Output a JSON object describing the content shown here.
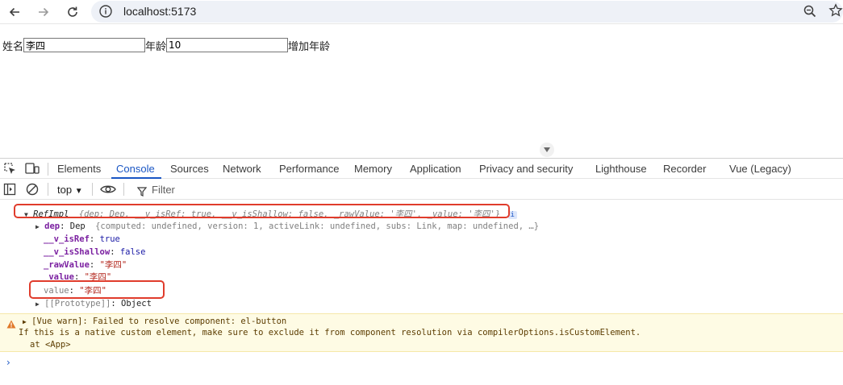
{
  "browser": {
    "url": "localhost:5173",
    "icons": [
      "back-icon",
      "forward-icon",
      "reload-icon",
      "site-info-icon",
      "zoom-icon",
      "bookmark-star-icon"
    ]
  },
  "page": {
    "name_label": "姓名",
    "name_value": "李四",
    "age_label": "年龄",
    "age_value": "10",
    "add_age_label": "增加年龄"
  },
  "devtools": {
    "tabs": [
      "Elements",
      "Console",
      "Sources",
      "Network",
      "Performance",
      "Memory",
      "Application",
      "Privacy and security",
      "Lighthouse",
      "Recorder",
      "Vue (Legacy)"
    ],
    "active_tab": "Console",
    "context": "top",
    "filter_placeholder": "Filter"
  },
  "console": {
    "object_summary": {
      "class_name": "RefImpl",
      "preview": "{dep: Dep, __v_isRef: true, __v_isShallow: false, _rawValue: '李四', _value: '李四'}",
      "info_badge": "i"
    },
    "dep_row": {
      "key": "dep",
      "type": "Dep",
      "preview": "{computed: undefined, version: 1, activeLink: undefined, subs: Link, map: undefined, …}"
    },
    "props": [
      {
        "key": "__v_isRef",
        "value": "true",
        "kind": "keyword"
      },
      {
        "key": "__v_isShallow",
        "value": "false",
        "kind": "keyword"
      },
      {
        "key": "_rawValue",
        "value": "\"李四\"",
        "kind": "string"
      },
      {
        "key": "_value",
        "value": "\"李四\"",
        "kind": "string"
      }
    ],
    "accessor": {
      "key": "value",
      "value": "\"李四\""
    },
    "prototype": {
      "key": "[[Prototype]]",
      "value": "Object"
    },
    "warning": {
      "line1": "[Vue warn]: Failed to resolve component: el-button",
      "line2": "If this is a native custom element, make sure to exclude it from component resolution via compilerOptions.isCustomElement.",
      "line3": "at <App>"
    },
    "prompt": "›"
  },
  "colors": {
    "accent": "#1a56c4",
    "highlight_box": "#e03c2c",
    "warning_bg": "#fefbe4"
  }
}
